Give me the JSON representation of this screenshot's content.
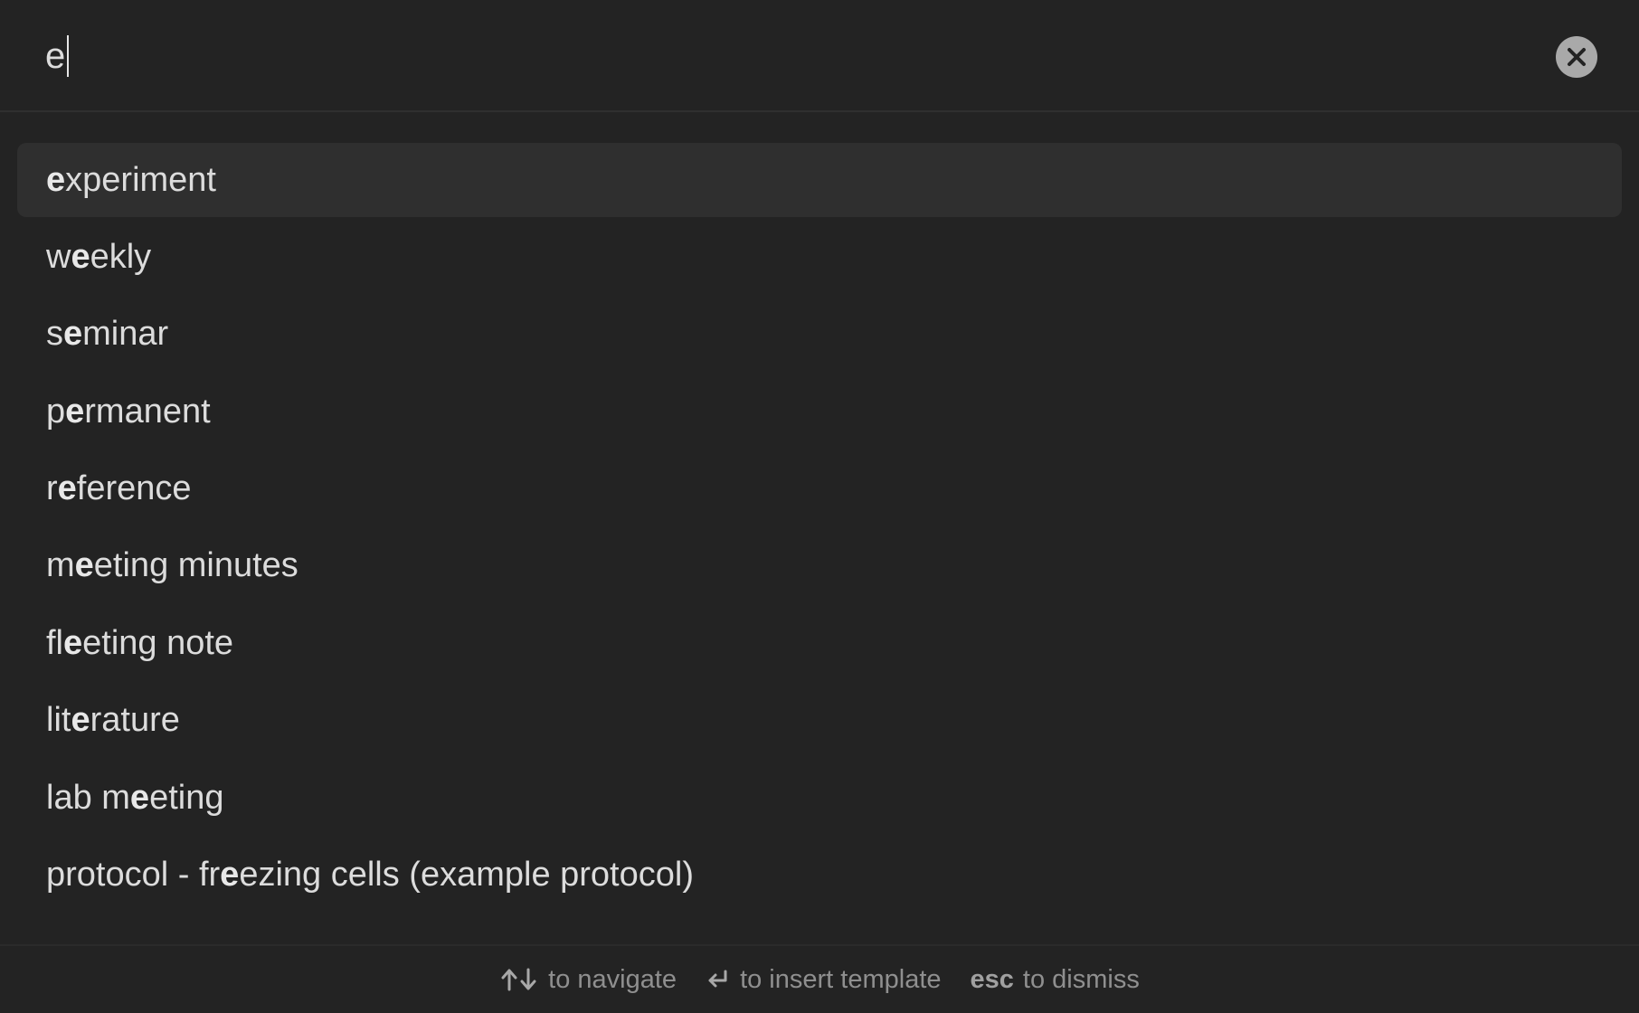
{
  "search": {
    "value": "e",
    "clear_icon": "close-circle-icon"
  },
  "suggestions": [
    {
      "text": "experiment",
      "highlight_index": 0,
      "selected": true
    },
    {
      "text": "weekly",
      "highlight_index": 1,
      "selected": false
    },
    {
      "text": "seminar",
      "highlight_index": 1,
      "selected": false
    },
    {
      "text": "permanent",
      "highlight_index": 1,
      "selected": false
    },
    {
      "text": "reference",
      "highlight_index": 1,
      "selected": false
    },
    {
      "text": "meeting minutes",
      "highlight_index": 1,
      "selected": false
    },
    {
      "text": "fleeting note",
      "highlight_index": 2,
      "selected": false
    },
    {
      "text": "literature",
      "highlight_index": 3,
      "selected": false
    },
    {
      "text": "lab meeting",
      "highlight_index": 5,
      "selected": false
    },
    {
      "text": "protocol - freezing cells (example protocol)",
      "highlight_index": 13,
      "selected": false
    }
  ],
  "footer": {
    "hints": [
      {
        "key_icon": "arrows-up-down-icon",
        "label": "to navigate"
      },
      {
        "key_icon": "enter-key-icon",
        "label": "to insert template"
      },
      {
        "key_text": "esc",
        "label": "to dismiss"
      }
    ]
  },
  "colors": {
    "background": "#232323",
    "selected_row": "#2f2f2f",
    "text": "#dcdcdc",
    "muted_text": "#8f8f8f",
    "clear_button": "#a9a9a9"
  }
}
